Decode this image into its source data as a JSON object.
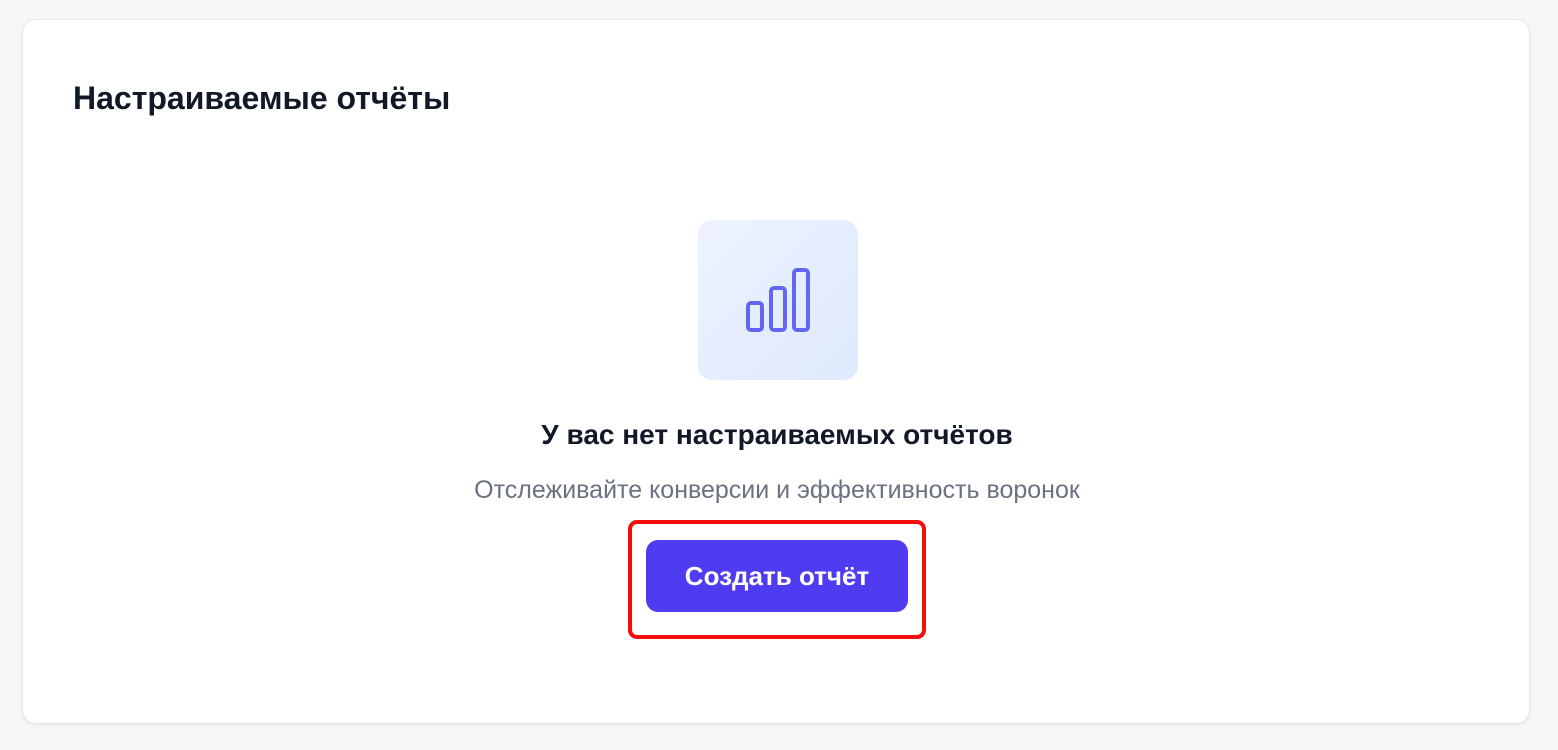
{
  "card": {
    "title": "Настраиваемые отчёты"
  },
  "empty_state": {
    "icon": "bar-chart-icon",
    "title": "У вас нет настраиваемых отчётов",
    "subtitle": "Отслеживайте конверсии и эффективность воронок",
    "button_label": "Создать отчёт"
  },
  "colors": {
    "accent": "#4f3cf0",
    "icon_stroke": "#6366f1",
    "highlight": "#f50c0c",
    "title_text": "#111827",
    "muted_text": "#6b7280"
  }
}
